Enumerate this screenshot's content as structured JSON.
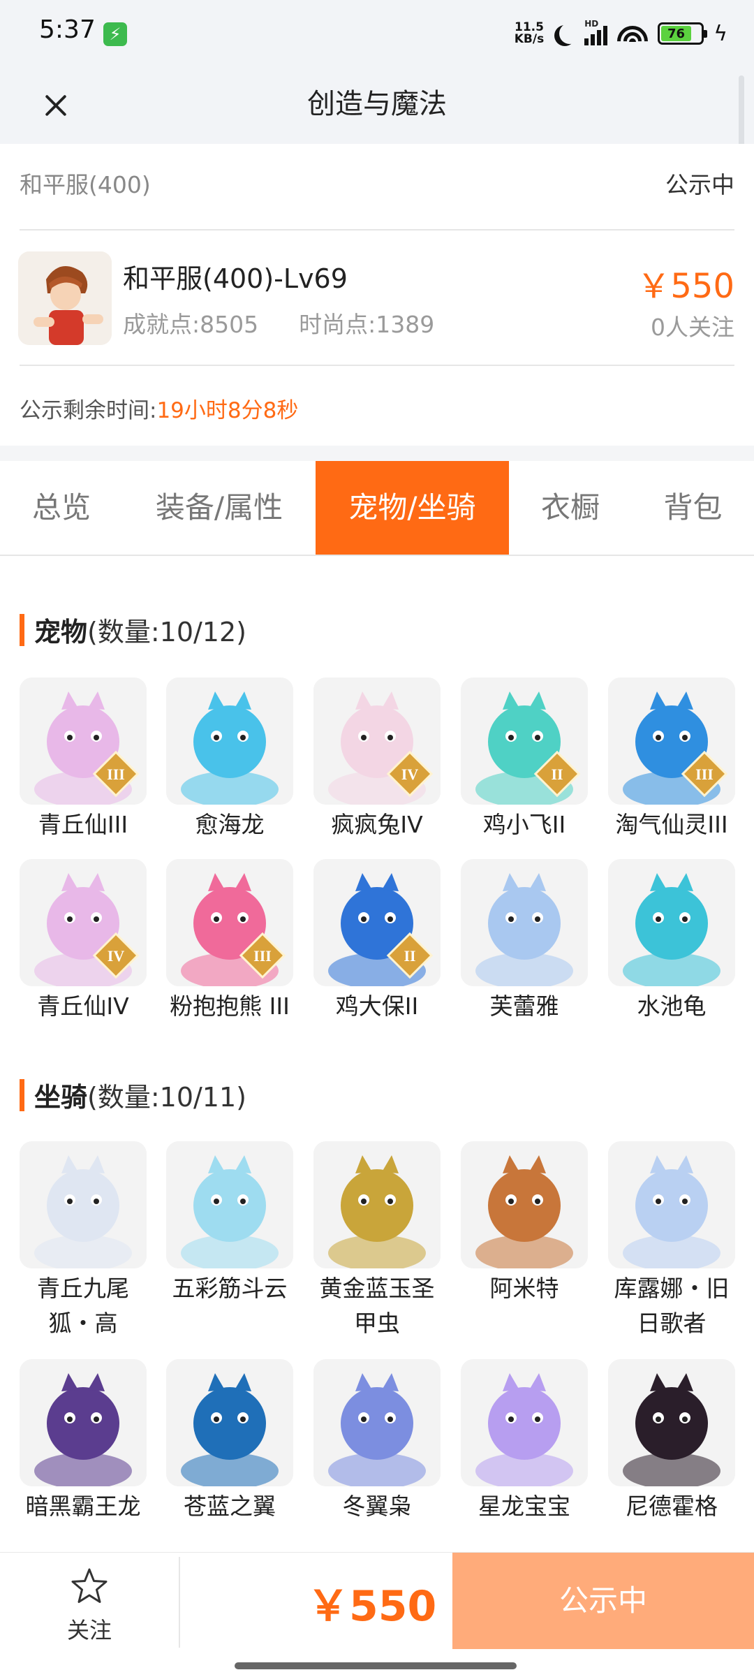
{
  "status_bar": {
    "time": "5:37",
    "net_speed_top": "11.5",
    "net_speed_bottom": "KB/s",
    "signal_label": "HD",
    "wifi_label": "6",
    "battery": "76",
    "battery_level": 0.76,
    "charge_icon": "bolt-icon"
  },
  "header": {
    "title": "创造与魔法",
    "close_icon": "close-icon"
  },
  "account": {
    "server": "和平服(400)",
    "status": "公示中",
    "name": "和平服(400)-Lv69",
    "achievement": "成就点:8505",
    "fashion": "时尚点:1389",
    "price": "￥550",
    "followers": "0人关注",
    "remaining_label": "公示剩余时间:",
    "remaining_value": "19小时8分8秒"
  },
  "tabs": [
    "总览",
    "装备/属性",
    "宠物/坐骑",
    "衣橱",
    "背包"
  ],
  "active_tab": 2,
  "pets": {
    "title": "宠物",
    "count": "(数量:10/12)",
    "items": [
      {
        "name": "青丘仙III",
        "tier": "III",
        "color": "#e8b8e8"
      },
      {
        "name": "愈海龙",
        "tier": "",
        "color": "#49c2ea"
      },
      {
        "name": "疯疯兔IV",
        "tier": "IV",
        "color": "#f3d6e4"
      },
      {
        "name": "鸡小飞II",
        "tier": "II",
        "color": "#4fd1c5"
      },
      {
        "name": "淘气仙灵III",
        "tier": "III",
        "color": "#2f8fe0"
      },
      {
        "name": "青丘仙IV",
        "tier": "IV",
        "color": "#e8b8e8"
      },
      {
        "name": "粉抱抱熊 III",
        "tier": "III",
        "color": "#f06a9a"
      },
      {
        "name": "鸡大保II",
        "tier": "II",
        "color": "#2f74d8"
      },
      {
        "name": "芙蕾雅",
        "tier": "",
        "color": "#a9c8f0"
      },
      {
        "name": "水池龟",
        "tier": "",
        "color": "#3cc3d8"
      }
    ]
  },
  "mounts": {
    "title": "坐骑",
    "count": "(数量:10/11)",
    "items": [
      {
        "name": "青丘九尾狐・高",
        "color": "#dfe6f2"
      },
      {
        "name": "五彩筋斗云",
        "color": "#9edcf0"
      },
      {
        "name": "黄金蓝玉圣甲虫",
        "color": "#c9a53a"
      },
      {
        "name": "阿米特",
        "color": "#c8763a"
      },
      {
        "name": "库露娜・旧日歌者",
        "color": "#b9d0f2"
      },
      {
        "name": "暗黑霸王龙",
        "color": "#5b3d8f"
      },
      {
        "name": "苍蓝之翼",
        "color": "#1f6fb8"
      },
      {
        "name": "冬翼枭",
        "color": "#7c8ee0"
      },
      {
        "name": "星龙宝宝",
        "color": "#b79ef0"
      },
      {
        "name": "尼德霍格",
        "color": "#2a1e2a"
      }
    ]
  },
  "bottom_bar": {
    "follow_label": "关注",
    "follow_icon": "star-icon",
    "price": "￥550",
    "action_label": "公示中"
  },
  "colors": {
    "accent": "#ff6a14",
    "accent_light": "#ffab7a"
  }
}
